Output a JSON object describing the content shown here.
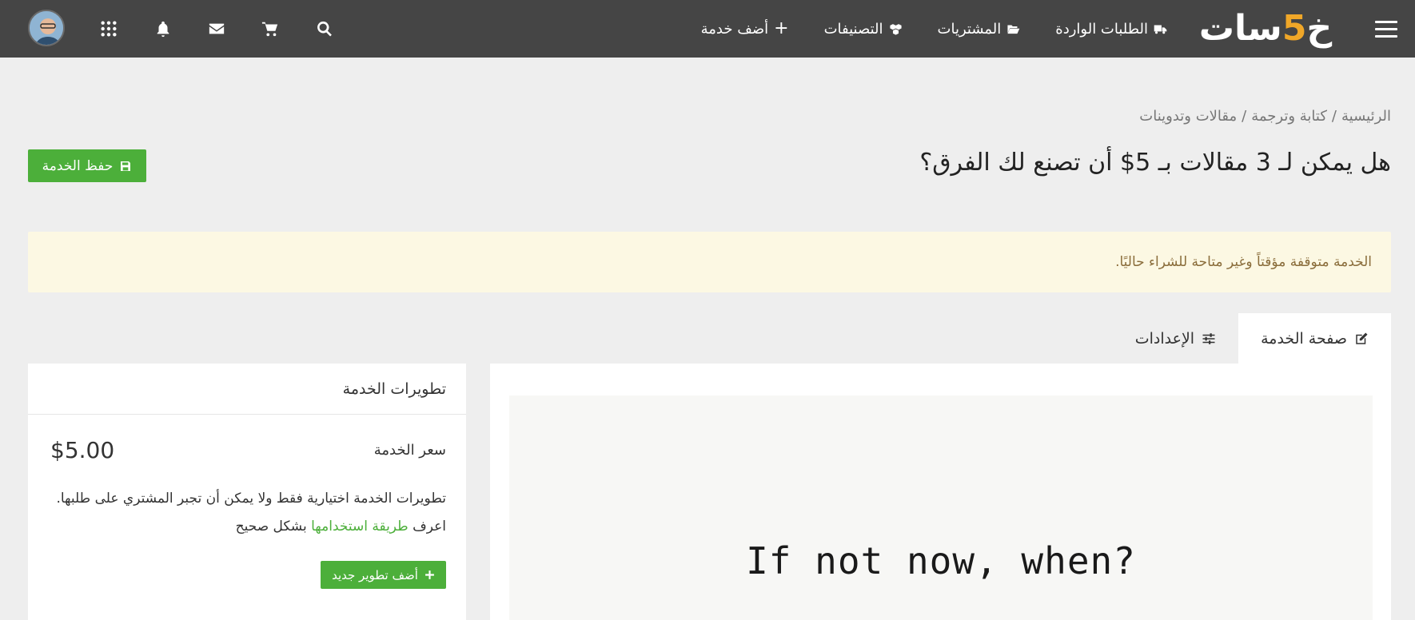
{
  "colors": {
    "navbar_bg": "#454545",
    "page_bg": "#eeeeee",
    "brand_green": "#4caf3a",
    "logo_accent": "#f0a728",
    "alert_bg": "#fcf8e3",
    "alert_text": "#8a6d3b"
  },
  "navbar": {
    "logo_part1": "خ",
    "logo_accent": "5",
    "logo_part2": "سات",
    "menu_icon": "hamburger-icon",
    "items": [
      {
        "label": "أضف خدمة",
        "icon": "plus-icon"
      },
      {
        "label": "التصنيفات",
        "icon": "cubes-icon"
      },
      {
        "label": "المشتريات",
        "icon": "folder-open-icon"
      },
      {
        "label": "الطلبات الواردة",
        "icon": "truck-icon"
      }
    ],
    "icons": [
      "search-icon",
      "cart-icon",
      "envelope-icon",
      "bell-icon",
      "apps-grid-icon",
      "avatar"
    ]
  },
  "breadcrumb": {
    "items": [
      "الرئيسية",
      "كتابة وترجمة",
      "مقالات وتدوينات"
    ],
    "separator": "/"
  },
  "page": {
    "title": "هل يمكن لـ 3 مقالات بـ 5$ أن تصنع لك الفرق؟",
    "save_label": "حفظ الخدمة"
  },
  "alert": {
    "message": "الخدمة متوقفة مؤقتاً وغير متاحة للشراء حاليًا."
  },
  "tabs": [
    {
      "label": "صفحة الخدمة",
      "icon": "edit-icon",
      "active": true
    },
    {
      "label": "الإعدادات",
      "icon": "sliders-icon",
      "active": false
    }
  ],
  "preview": {
    "image_text": "If not now, when?"
  },
  "upgrades": {
    "title": "تطويرات الخدمة",
    "price_label": "سعر الخدمة",
    "price_value": "$5.00",
    "note_line1": "تطويرات الخدمة اختيارية فقط ولا يمكن أن تجبر المشتري على طلبها.",
    "note_prefix": "اعرف",
    "note_link": "طريقة استخدامها",
    "note_suffix": "بشكل صحيح",
    "add_label": "أضف تطوير جديد"
  }
}
